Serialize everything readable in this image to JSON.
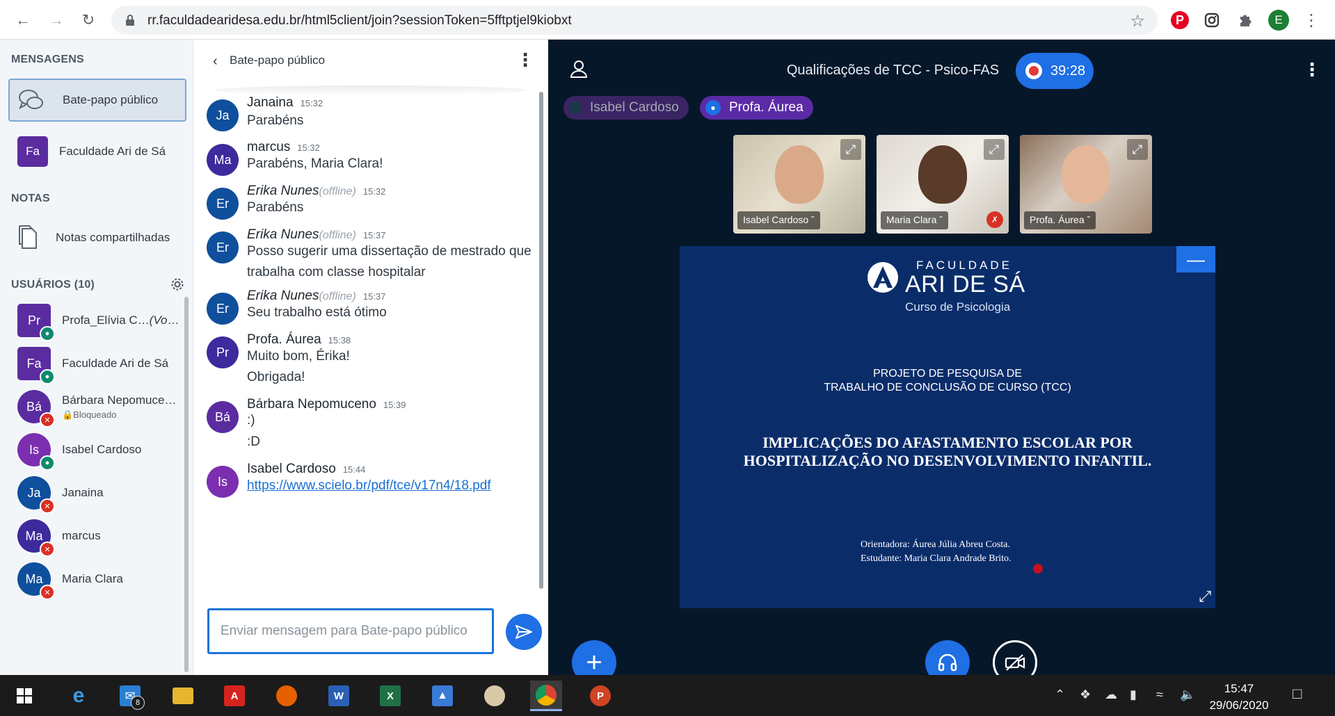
{
  "browser": {
    "url": "rr.faculdadearidesa.edu.br/html5client/join?sessionToken=5fftptjel9kiobxt",
    "profile_initial": "E"
  },
  "sidebar": {
    "messages_title": "MENSAGENS",
    "public_chat_label": "Bate-papo público",
    "private_chat": {
      "avatar": "Fa",
      "label": "Faculdade Ari de Sá"
    },
    "notes_title": "NOTAS",
    "shared_notes_label": "Notas compartilhadas",
    "users_title": "USUÁRIOS (10)",
    "users": [
      {
        "initials": "Pr",
        "name": "Profa_Elívia C…",
        "you": "(Você)",
        "status": "headset",
        "shape": "square",
        "color": "#5a2ca0"
      },
      {
        "initials": "Fa",
        "name": "Faculdade Ari de Sá",
        "status": "headset",
        "shape": "square",
        "color": "#5a2ca0"
      },
      {
        "initials": "Bá",
        "name": "Bárbara Nepomuce…",
        "sub": "🔒Bloqueado",
        "status": "muted",
        "shape": "circle",
        "color": "#5a2ca0"
      },
      {
        "initials": "Is",
        "name": "Isabel Cardoso",
        "status": "mic",
        "shape": "circle",
        "color": "#7b2fb0"
      },
      {
        "initials": "Ja",
        "name": "Janaina",
        "status": "muted",
        "shape": "circle",
        "color": "#0f4f9c"
      },
      {
        "initials": "Ma",
        "name": "marcus",
        "status": "muted",
        "shape": "circle",
        "color": "#3d2a9c"
      },
      {
        "initials": "Ma",
        "name": "Maria Clara",
        "status": "muted",
        "shape": "circle",
        "color": "#0f4f9c"
      }
    ]
  },
  "chat": {
    "title": "Bate-papo público",
    "input_placeholder": "Enviar mensagem para Bate-papo público",
    "offline_label": "(offline)",
    "messages": [
      {
        "avatar": "Ja",
        "color": "#0f4f9c",
        "name": "Janaina",
        "time": "15:32",
        "lines": [
          "Parabéns"
        ]
      },
      {
        "avatar": "Ma",
        "color": "#3d2a9c",
        "name": "marcus",
        "time": "15:32",
        "lines": [
          "Parabéns, Maria Clara!"
        ]
      },
      {
        "avatar": "Er",
        "color": "#0f4f9c",
        "name": "Erika Nunes",
        "time": "15:32",
        "offline": true,
        "lines": [
          "Parabéns"
        ]
      },
      {
        "avatar": "Er",
        "color": "#0f4f9c",
        "name": "Erika Nunes",
        "time": "15:37",
        "offline": true,
        "lines": [
          "Posso sugerir uma dissertação de mestrado que",
          "trabalha com classe hospitalar"
        ]
      },
      {
        "avatar": "Er",
        "color": "#0f4f9c",
        "name": "Erika Nunes",
        "time": "15:37",
        "offline": true,
        "lines": [
          "Seu trabalho está ótimo"
        ]
      },
      {
        "avatar": "Pr",
        "color": "#3d2a9c",
        "name": "Profa. Áurea",
        "time": "15:38",
        "lines": [
          "Muito bom, Érika!",
          "Obrigada!"
        ]
      },
      {
        "avatar": "Bá",
        "color": "#5a2ca0",
        "name": "Bárbara Nepomuceno",
        "time": "15:39",
        "lines": [
          ":)",
          ":D"
        ]
      },
      {
        "avatar": "Is",
        "color": "#7b2fb0",
        "name": "Isabel Cardoso",
        "time": "15:44",
        "link": "https://www.scielo.br/pdf/tce/v17n4/18.pdf"
      }
    ]
  },
  "meeting": {
    "title": "Qualificações de TCC - Psico-FAS",
    "recording_time": "39:28",
    "talkers": [
      {
        "name": "Isabel Cardoso",
        "state": "inactive"
      },
      {
        "name": "Profa. Áurea",
        "state": "talking"
      }
    ],
    "videos": [
      {
        "name": "Isabel Cardoso",
        "muted": false
      },
      {
        "name": "Maria Clara",
        "muted": true
      },
      {
        "name": "Profa. Áurea",
        "muted": false
      }
    ],
    "slide": {
      "brand_top": "FACULDADE",
      "brand_main": "ARI DE SÁ",
      "brand_sub": "Curso de Psicologia",
      "project_line1": "PROJETO DE PESQUISA DE",
      "project_line2": "TRABALHO DE CONCLUSÃO DE CURSO (TCC)",
      "title_line1": "IMPLICAÇÕES DO AFASTAMENTO ESCOLAR POR",
      "title_line2": "HOSPITALIZAÇÃO NO DESENVOLVIMENTO INFANTIL.",
      "advisor": "Orientadora: Áurea Júlia Abreu Costa.",
      "student": "Estudante: Maria Clara Andrade Brito."
    }
  },
  "taskbar": {
    "mail_badge": "8",
    "clock_time": "15:47",
    "clock_date": "29/06/2020"
  }
}
